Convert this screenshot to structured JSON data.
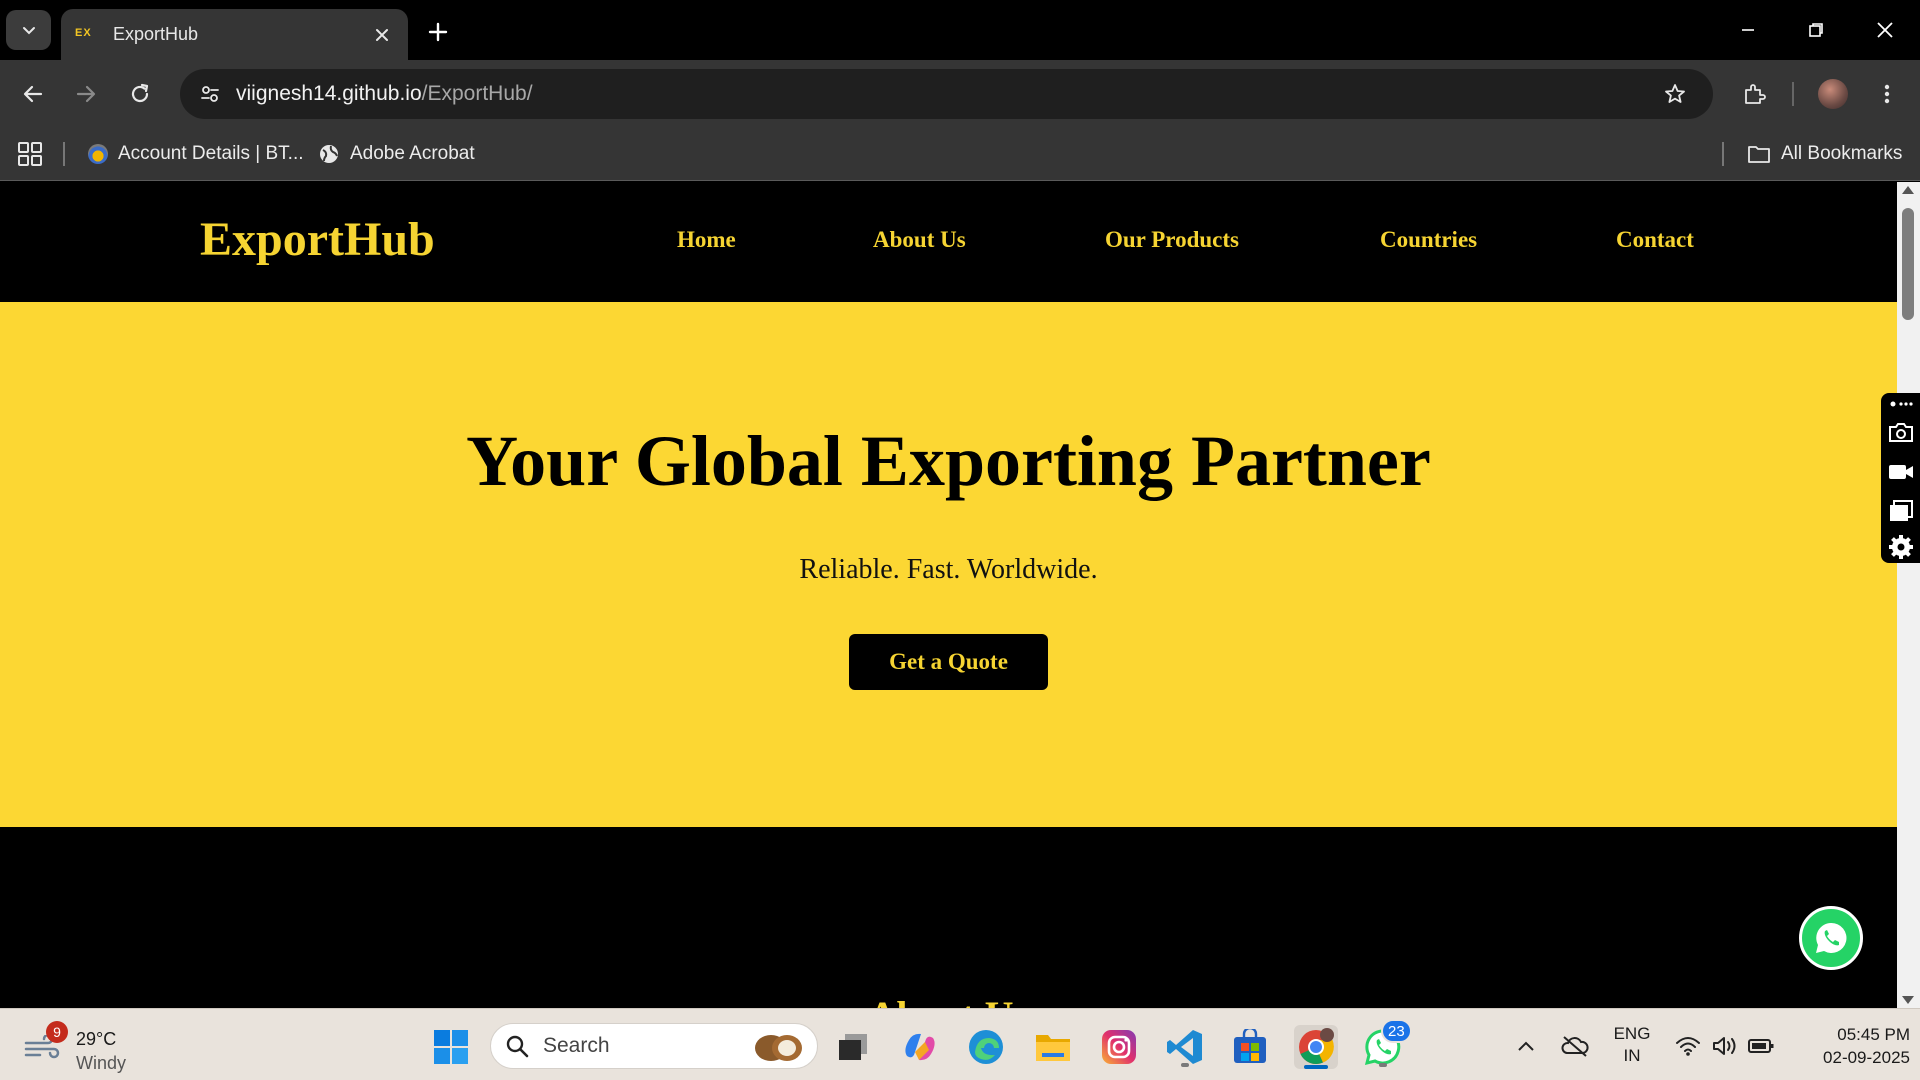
{
  "browser": {
    "tab": {
      "title": "ExportHub",
      "favicon_text": "EX"
    },
    "address": {
      "host": "viignesh14.github.io",
      "path": "/ExportHub/"
    },
    "bookmarks": [
      {
        "label": "Account Details | BT..."
      },
      {
        "label": "Adobe Acrobat"
      }
    ],
    "all_bookmarks_label": "All Bookmarks"
  },
  "site": {
    "logo": "ExportHub",
    "nav": [
      "Home",
      "About Us",
      "Our Products",
      "Countries",
      "Contact"
    ],
    "hero": {
      "title": "Your Global Exporting Partner",
      "subtitle": "Reliable. Fast. Worldwide.",
      "cta": "Get a Quote"
    },
    "next_section_title_peek": "About Us"
  },
  "taskbar": {
    "weather": {
      "badge": "9",
      "temp": "29°C",
      "condition": "Windy"
    },
    "search_placeholder": "Search",
    "whatsapp_badge": "23",
    "language": {
      "line1": "ENG",
      "line2": "IN"
    },
    "clock": {
      "time": "05:45 PM",
      "date": "02-09-2025"
    }
  },
  "colors": {
    "accent_yellow": "#fcd733",
    "brand_yellow_text": "#f6d432",
    "page_black": "#000000",
    "chrome_gray": "#353535"
  }
}
